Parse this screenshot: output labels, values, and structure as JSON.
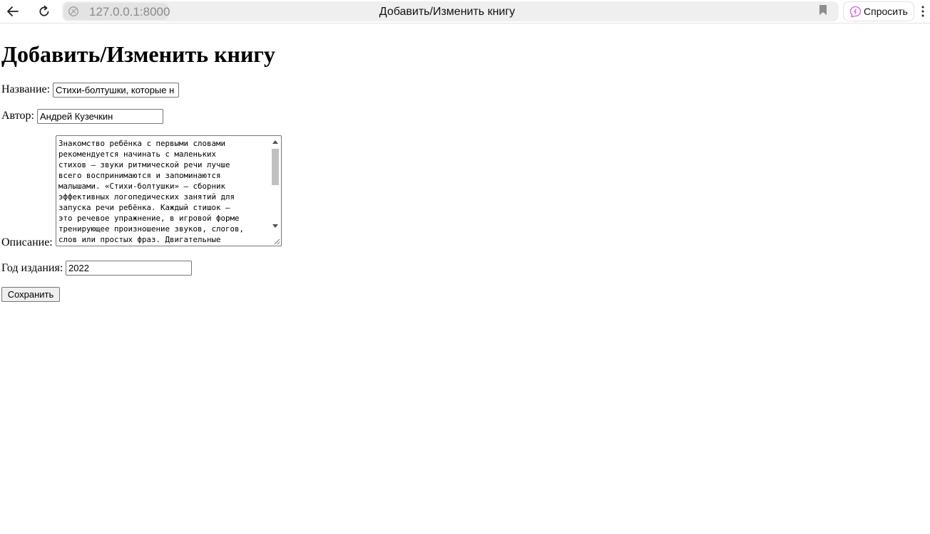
{
  "browser": {
    "url": "127.0.0.1:8000",
    "tab_title": "Добавить/Изменить книгу",
    "ask_label": "Спросить",
    "accent_color": "#d65ad6",
    "icons": {
      "back": "arrow-left-icon",
      "reload": "reload-icon",
      "site": "site-info-icon",
      "bookmark": "bookmark-icon",
      "ask": "ai-chat-icon",
      "menu": "kebab-menu-icon"
    }
  },
  "page": {
    "title": "Добавить/Изменить книгу"
  },
  "form": {
    "name_label": "Название:",
    "name_value": "Стихи-болтушки, которые н",
    "author_label": "Автор:",
    "author_value": "Андрей Кузечкин",
    "description_label": "Описание:",
    "description_value": "Знакомство ребёнка с первыми словами\nрекомендуется начинать с маленьких\nстихов – звуки ритмической речи лучше\nвсего воспринимаются и запоминаются\nмалышами. «Стихи-болтушки» – сборник\nэффективных логопедических занятий для\nзапуска речи ребёнка. Каждый стишок –\nэто речевое упражнение, в игровой форме\nтренирующее произношение звуков, слогов,\nслов или простых фраз. Двигательные",
    "year_label": "Год издания:",
    "year_value": "2022",
    "save_label": "Сохранить"
  }
}
